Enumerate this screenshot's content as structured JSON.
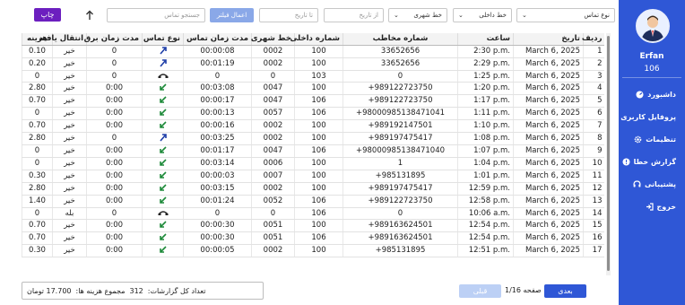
{
  "sidebar": {
    "user_name": "Erfan",
    "user_number": "106",
    "items": [
      {
        "label": "داشبورد",
        "icon": "dashboard-icon",
        "glyph": "◉"
      },
      {
        "label": "پروفایل کاربری",
        "icon": "user-icon",
        "glyph": "●"
      },
      {
        "label": "تنظیمات",
        "icon": "gear-icon",
        "glyph": "✱"
      },
      {
        "label": "گزارش خطا",
        "icon": "alert-icon",
        "glyph": "!"
      },
      {
        "label": "پشتیبانی",
        "icon": "support-icon",
        "glyph": "◍"
      },
      {
        "label": "خروج",
        "icon": "logout-icon",
        "glyph": "⇥"
      }
    ]
  },
  "toolbar": {
    "print_label": "چاپ",
    "sort_icon": "arrow-up-icon",
    "search_placeholder": "جستجو تماس",
    "apply_filter_label": "اعمال فیلتر",
    "to_date_placeholder": "تا تاریخ",
    "from_date_placeholder": "از تاریخ",
    "city_line_label": "خط شهری",
    "internal_line_label": "خط داخلی",
    "call_type_label": "نوع تماس"
  },
  "table": {
    "headers": [
      "ردیف",
      "تاریخ",
      "ساعت",
      "شماره مخاطب",
      "شماره داخلی",
      "خط شهری",
      "مدت زمان تماس",
      "نوع تماس",
      "مدت زمان برق",
      "انتقال یافته",
      "هزینه"
    ],
    "rows": [
      {
        "row": "1",
        "date": "March 6, 2025",
        "time": "2:30 p.m.",
        "contact": "33652656",
        "ext": "100",
        "line": "0002",
        "duration": "00:00:08",
        "type": "outgoing",
        "power": "0",
        "transferred": "خیر",
        "cost": "0.10"
      },
      {
        "row": "2",
        "date": "March 6, 2025",
        "time": "2:29 p.m.",
        "contact": "33652656",
        "ext": "100",
        "line": "0002",
        "duration": "00:01:19",
        "type": "outgoing",
        "power": "0",
        "transferred": "خیر",
        "cost": "0.20"
      },
      {
        "row": "3",
        "date": "March 6, 2025",
        "time": "1:25 p.m.",
        "contact": "0",
        "ext": "103",
        "line": "0",
        "duration": "0",
        "type": "missed",
        "power": "0",
        "transferred": "خیر",
        "cost": "0"
      },
      {
        "row": "4",
        "date": "March 6, 2025",
        "time": "1:20 p.m.",
        "contact": "+989122723750",
        "ext": "100",
        "line": "0047",
        "duration": "00:03:08",
        "type": "incoming",
        "power": "0:00",
        "transferred": "خیر",
        "cost": "2.80"
      },
      {
        "row": "5",
        "date": "March 6, 2025",
        "time": "1:17 p.m.",
        "contact": "+989122723750",
        "ext": "106",
        "line": "0047",
        "duration": "00:00:17",
        "type": "incoming",
        "power": "0:00",
        "transferred": "خیر",
        "cost": "0.70"
      },
      {
        "row": "6",
        "date": "March 6, 2025",
        "time": "1:11 p.m.",
        "contact": "+98000985138471041",
        "ext": "106",
        "line": "0057",
        "duration": "00:00:13",
        "type": "incoming",
        "power": "0:00",
        "transferred": "خیر",
        "cost": "0"
      },
      {
        "row": "7",
        "date": "March 6, 2025",
        "time": "1:10 p.m.",
        "contact": "+989192147501",
        "ext": "100",
        "line": "0002",
        "duration": "00:00:16",
        "type": "incoming",
        "power": "0:00",
        "transferred": "خیر",
        "cost": "0.70"
      },
      {
        "row": "8",
        "date": "March 6, 2025",
        "time": "1:08 p.m.",
        "contact": "+989197475417",
        "ext": "100",
        "line": "0002",
        "duration": "00:03:25",
        "type": "outgoing",
        "power": "0",
        "transferred": "خیر",
        "cost": "2.80"
      },
      {
        "row": "9",
        "date": "March 6, 2025",
        "time": "1:07 p.m.",
        "contact": "+98000985138471040",
        "ext": "106",
        "line": "0047",
        "duration": "00:01:17",
        "type": "incoming",
        "power": "0:00",
        "transferred": "خیر",
        "cost": "0"
      },
      {
        "row": "10",
        "date": "March 6, 2025",
        "time": "1:04 p.m.",
        "contact": "1",
        "ext": "100",
        "line": "0006",
        "duration": "00:03:14",
        "type": "incoming",
        "power": "0:00",
        "transferred": "خیر",
        "cost": "0"
      },
      {
        "row": "11",
        "date": "March 6, 2025",
        "time": "1:01 p.m.",
        "contact": "+985131895",
        "ext": "100",
        "line": "0007",
        "duration": "00:00:03",
        "type": "incoming",
        "power": "0:00",
        "transferred": "خیر",
        "cost": "0.30"
      },
      {
        "row": "12",
        "date": "March 6, 2025",
        "time": "12:59 p.m.",
        "contact": "+989197475417",
        "ext": "100",
        "line": "0002",
        "duration": "00:03:15",
        "type": "incoming",
        "power": "0:00",
        "transferred": "خیر",
        "cost": "2.80"
      },
      {
        "row": "13",
        "date": "March 6, 2025",
        "time": "12:58 p.m.",
        "contact": "+989122723750",
        "ext": "106",
        "line": "0052",
        "duration": "00:01:24",
        "type": "incoming",
        "power": "0:00",
        "transferred": "خیر",
        "cost": "1.40"
      },
      {
        "row": "14",
        "date": "March 6, 2025",
        "time": "10:06 a.m.",
        "contact": "0",
        "ext": "106",
        "line": "0",
        "duration": "0",
        "type": "missed",
        "power": "0",
        "transferred": "بله",
        "cost": "0"
      },
      {
        "row": "15",
        "date": "March 6, 2025",
        "time": "12:54 p.m.",
        "contact": "+989163624501",
        "ext": "100",
        "line": "0051",
        "duration": "00:00:30",
        "type": "incoming",
        "power": "0:00",
        "transferred": "خیر",
        "cost": "0.70"
      },
      {
        "row": "16",
        "date": "March 6, 2025",
        "time": "12:54 p.m.",
        "contact": "+989163624501",
        "ext": "106",
        "line": "0051",
        "duration": "00:00:30",
        "type": "incoming",
        "power": "0:00",
        "transferred": "خیر",
        "cost": "0.70"
      },
      {
        "row": "17",
        "date": "March 6, 2025",
        "time": "12:51 p.m.",
        "contact": "+985131895",
        "ext": "100",
        "line": "0002",
        "duration": "00:00:05",
        "type": "incoming",
        "power": "0:00",
        "transferred": "خیر",
        "cost": "0.30"
      }
    ]
  },
  "footer": {
    "report_count_label": "تعداد کل گزارشات:",
    "report_count": "312",
    "total_cost_label": "مجموع هزینه ها:",
    "total_cost": "17.700 تومان",
    "next_label": "بعدی",
    "page_info": "صفحه 1/16",
    "prev_label": "قبلی"
  },
  "colors": {
    "sidebar": "#2f57d6",
    "print_button": "#6c1fbf",
    "filter_button": "#8aa8e8",
    "outgoing_arrow": "#1f3fa8",
    "incoming_arrow": "#1e8a3a"
  }
}
